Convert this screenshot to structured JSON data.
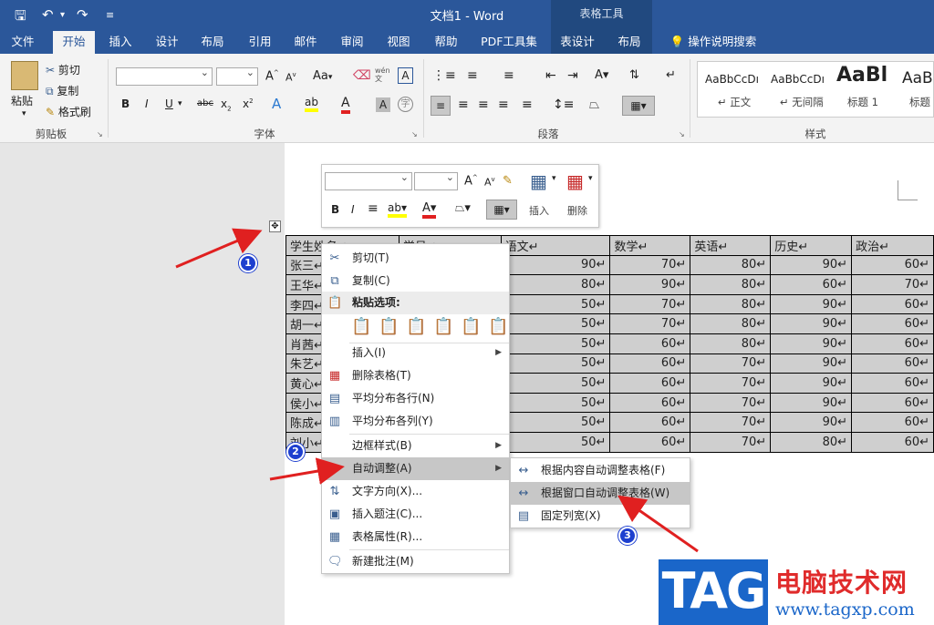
{
  "window": {
    "title": "文档1  -  Word",
    "context_tab_group": "表格工具"
  },
  "tabs": [
    {
      "label": "文件"
    },
    {
      "label": "开始"
    },
    {
      "label": "插入"
    },
    {
      "label": "设计"
    },
    {
      "label": "布局"
    },
    {
      "label": "引用"
    },
    {
      "label": "邮件"
    },
    {
      "label": "审阅"
    },
    {
      "label": "视图"
    },
    {
      "label": "帮助"
    },
    {
      "label": "PDF工具集"
    },
    {
      "label": "表设计"
    },
    {
      "label": "布局"
    },
    {
      "label": "操作说明搜索"
    }
  ],
  "ribbon": {
    "clipboard": {
      "paste": "粘贴",
      "cut": "剪切",
      "copy": "复制",
      "format_painter": "格式刷",
      "group": "剪贴板"
    },
    "font": {
      "group": "字体",
      "aa": "Aa",
      "wen": "wén"
    },
    "paragraph": {
      "group": "段落"
    },
    "styles": {
      "group": "样式",
      "items": [
        {
          "preview": "AaBbCcDı",
          "name": "↵ 正文"
        },
        {
          "preview": "AaBbCcDı",
          "name": "↵ 无间隔"
        },
        {
          "preview": "AaBl",
          "name": "标题 1"
        },
        {
          "preview": "AaB",
          "name": "标题"
        }
      ]
    }
  },
  "mini_toolbar": {
    "insert": "插入",
    "delete": "删除"
  },
  "table": {
    "headers": [
      "学生姓名↵",
      "学号↵",
      "语文↵",
      "数学↵",
      "英语↵",
      "历史↵",
      "政治↵"
    ],
    "rows": [
      {
        "name": "张三↵",
        "vals": [
          "90↵",
          "70↵",
          "80↵",
          "90↵",
          "60↵"
        ]
      },
      {
        "name": "王华↵",
        "vals": [
          "80↵",
          "90↵",
          "80↵",
          "60↵",
          "70↵"
        ]
      },
      {
        "name": "李四↵",
        "vals": [
          "50↵",
          "70↵",
          "80↵",
          "90↵",
          "60↵"
        ]
      },
      {
        "name": "胡一↵",
        "vals": [
          "50↵",
          "70↵",
          "80↵",
          "90↵",
          "60↵"
        ]
      },
      {
        "name": "肖茜↵",
        "vals": [
          "50↵",
          "60↵",
          "80↵",
          "90↵",
          "60↵"
        ]
      },
      {
        "name": "朱艺↵",
        "vals": [
          "50↵",
          "60↵",
          "70↵",
          "90↵",
          "60↵"
        ]
      },
      {
        "name": "黄心↵",
        "vals": [
          "50↵",
          "60↵",
          "70↵",
          "90↵",
          "60↵"
        ]
      },
      {
        "name": "侯小↵",
        "vals": [
          "50↵",
          "60↵",
          "70↵",
          "90↵",
          "60↵"
        ]
      },
      {
        "name": "陈成↵",
        "vals": [
          "50↵",
          "60↵",
          "70↵",
          "90↵",
          "60↵"
        ]
      },
      {
        "name": "刘小↵",
        "vals": [
          "50↵",
          "60↵",
          "70↵",
          "80↵",
          "60↵"
        ]
      }
    ]
  },
  "context_menu": {
    "items": [
      {
        "label": "剪切(T)",
        "icon": "scissors-icon"
      },
      {
        "label": "复制(C)",
        "icon": "copy-icon"
      },
      {
        "label": "粘贴选项:",
        "icon": "paste-icon"
      },
      {
        "label": "插入(I)",
        "icon": ""
      },
      {
        "label": "删除表格(T)",
        "icon": "delete-table-icon"
      },
      {
        "label": "平均分布各行(N)",
        "icon": "distribute-rows-icon"
      },
      {
        "label": "平均分布各列(Y)",
        "icon": "distribute-columns-icon"
      },
      {
        "label": "边框样式(B)",
        "icon": ""
      },
      {
        "label": "自动调整(A)",
        "icon": ""
      },
      {
        "label": "文字方向(X)...",
        "icon": "text-direction-icon"
      },
      {
        "label": "插入题注(C)...",
        "icon": "caption-icon"
      },
      {
        "label": "表格属性(R)...",
        "icon": "table-properties-icon"
      },
      {
        "label": "新建批注(M)",
        "icon": "comment-icon"
      }
    ]
  },
  "submenu": {
    "items": [
      {
        "label": "根据内容自动调整表格(F)"
      },
      {
        "label": "根据窗口自动调整表格(W)"
      },
      {
        "label": "固定列宽(X)"
      }
    ]
  },
  "annotations": {
    "step1": "1",
    "step2": "2",
    "step3": "3"
  },
  "watermark": {
    "logo": "TAG",
    "line1": "电脑技术网",
    "line2": "www.tagxp.com"
  },
  "colors": {
    "word_blue": "#2b579a",
    "arrow_red": "#e02020",
    "highlight_gray": "#c7c7c7"
  }
}
